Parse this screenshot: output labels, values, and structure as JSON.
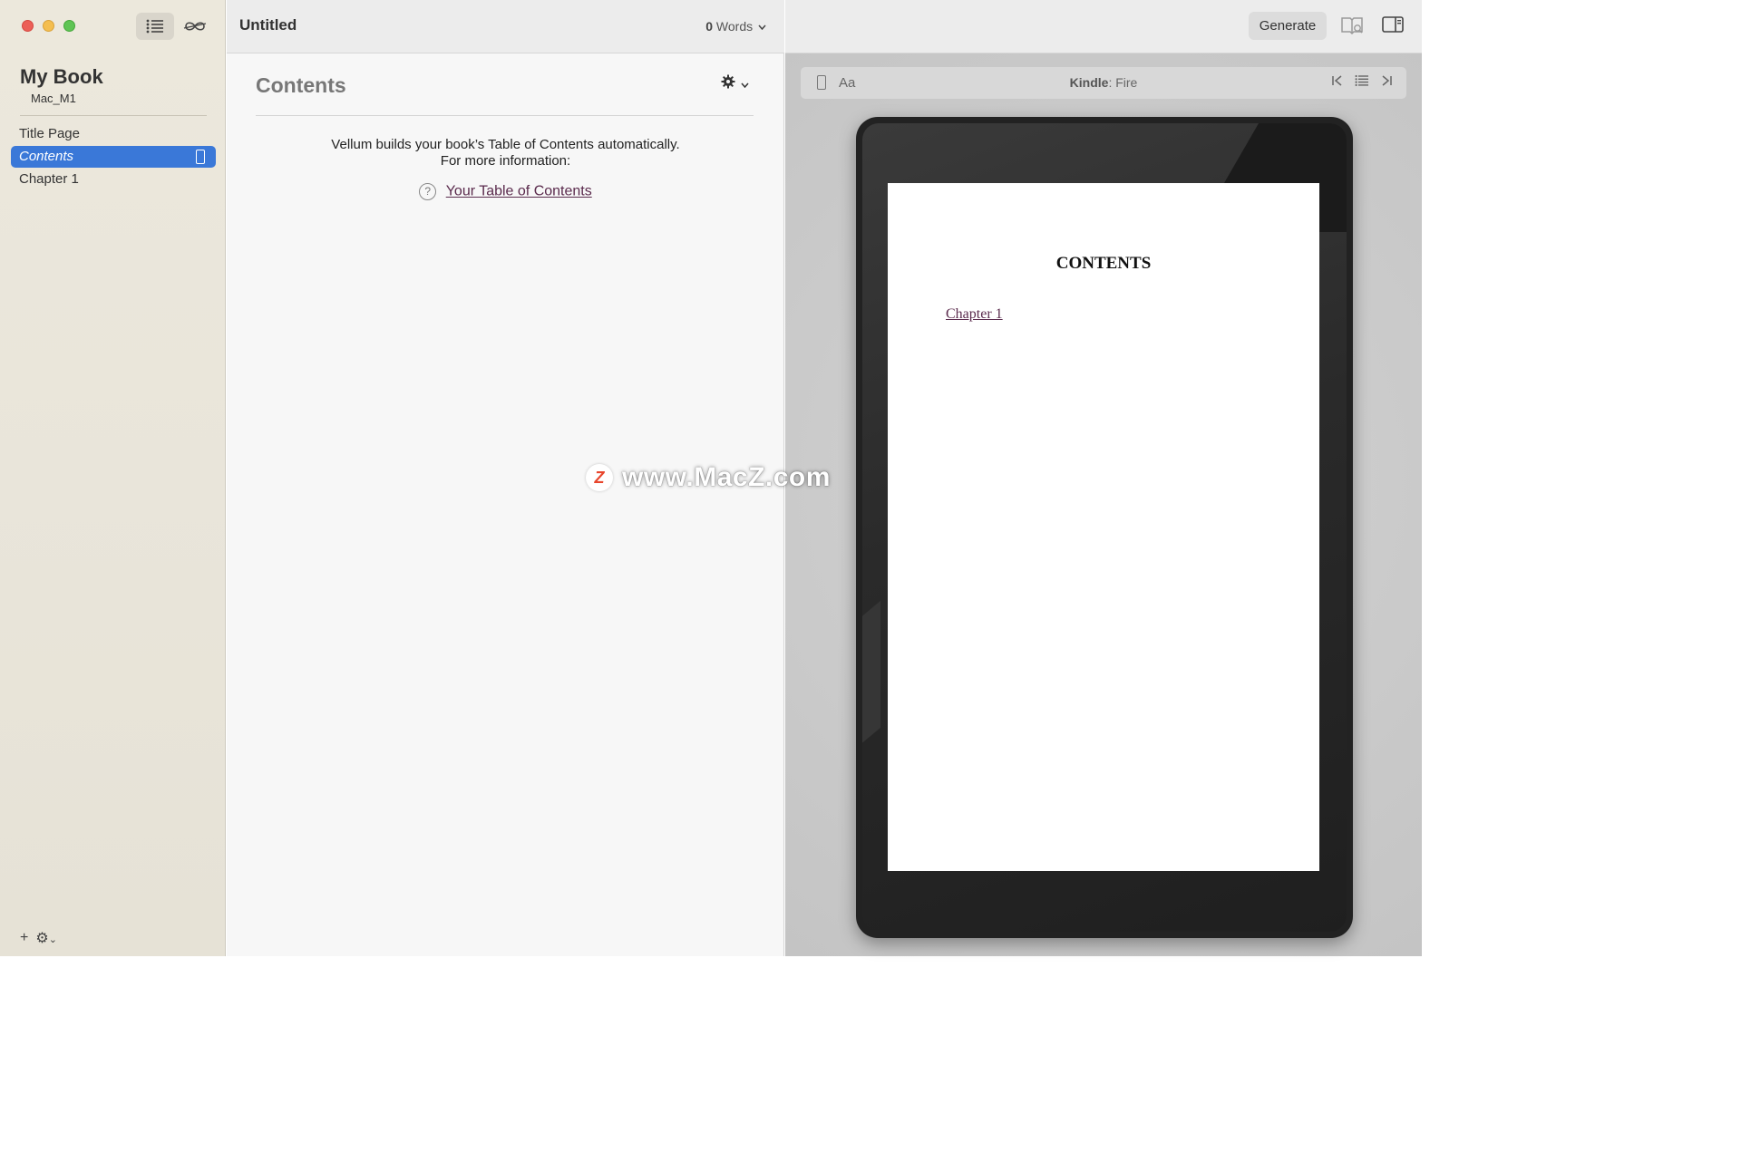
{
  "window": {
    "controls": [
      "close",
      "minimize",
      "zoom"
    ]
  },
  "sidebar": {
    "toolbar_icons": [
      "list-icon",
      "infinity-icon"
    ],
    "book_title": "My Book",
    "book_author": "Mac_M1",
    "items": [
      {
        "label": "Title Page",
        "active": false
      },
      {
        "label": "Contents",
        "active": true
      },
      {
        "label": "Chapter 1",
        "active": false
      }
    ],
    "bottom_add": "+",
    "bottom_gear": "⚙",
    "bottom_chevron": "⌄"
  },
  "editor": {
    "doc_title": "Untitled",
    "word_count": "0",
    "word_label": "Words",
    "section_heading": "Contents",
    "info_line1": "Vellum builds your book’s Table of Contents automatically.",
    "info_line2": "For more information:",
    "help_glyph": "?",
    "toc_link": "Your Table of Contents"
  },
  "preview": {
    "generate_label": "Generate",
    "aa_label": "Aa",
    "device_brand": "Kindle",
    "device_model": ": Fire",
    "nav_first": "|<",
    "nav_last": ">|",
    "page_heading": "CONTENTS",
    "page_link": "Chapter 1"
  },
  "watermark": {
    "logo": "Z",
    "text": "www.MacZ.com"
  },
  "colors": {
    "selection": "#3a78d8",
    "link": "#5a2a4c",
    "close": "#ec5f57",
    "minimize": "#f4be4f",
    "zoom": "#5fc454"
  }
}
